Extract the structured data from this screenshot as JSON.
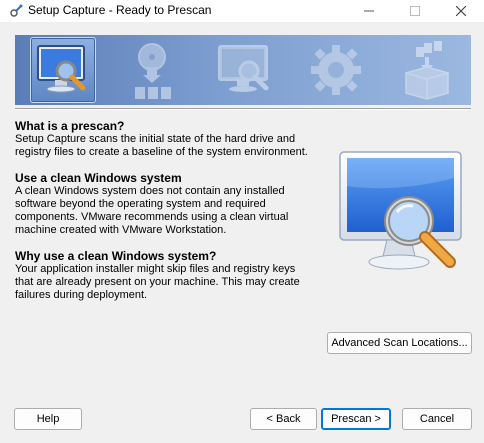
{
  "window": {
    "title": "Setup Capture - Ready to Prescan",
    "app_icon": "gear-wrench-icon",
    "controls": {
      "minimize": "minimize-icon",
      "maximize": "maximize-icon",
      "close": "close-icon"
    }
  },
  "wizard": {
    "steps": [
      {
        "name": "prescan",
        "icon": "monitor-magnifier-icon",
        "active": true
      },
      {
        "name": "install",
        "icon": "disc-install-icon",
        "active": false
      },
      {
        "name": "postscan",
        "icon": "monitor-magnifier-icon",
        "active": false
      },
      {
        "name": "configure",
        "icon": "gear-icon",
        "active": false
      },
      {
        "name": "package",
        "icon": "package-box-icon",
        "active": false
      }
    ]
  },
  "content": {
    "sections": [
      {
        "heading": "What is a prescan?",
        "body": "Setup Capture scans the initial state of the hard drive and registry files to create a baseline of the system environment."
      },
      {
        "heading": "Use a clean Windows system",
        "body": "A clean Windows system does not contain any installed software beyond the operating system and required components. VMware recommends using a clean virtual machine created with VMware Workstation."
      },
      {
        "heading": "Why use a clean Windows system?",
        "body": "Your application installer might skip files and registry keys that are already present on your machine. This may create failures during deployment."
      }
    ]
  },
  "buttons": {
    "advanced": "Advanced Scan Locations...",
    "help": "Help",
    "back": "< Back",
    "next": "Prescan >",
    "cancel": "Cancel"
  }
}
